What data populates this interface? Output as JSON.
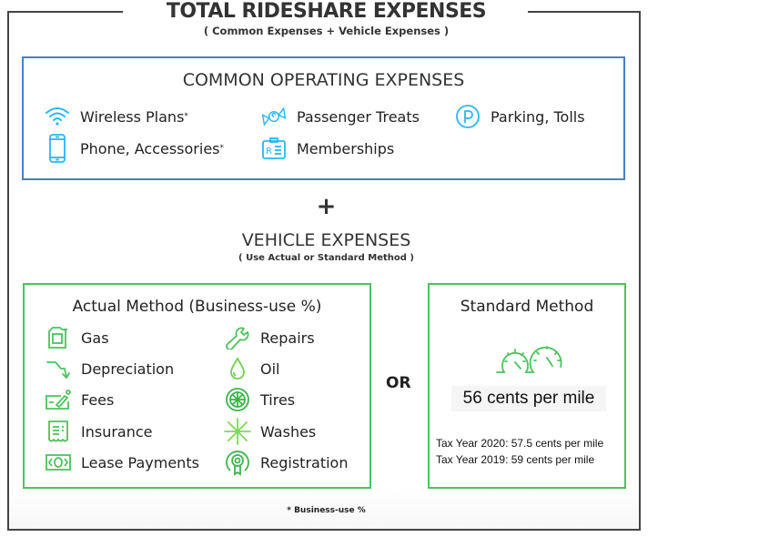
{
  "header": {
    "title": "TOTAL RIDESHARE EXPENSES",
    "subtitle": "( Common Expenses + Vehicle Expenses )"
  },
  "common": {
    "title": "COMMON OPERATING EXPENSES",
    "accent": "#29b6f6",
    "items": [
      {
        "label": "Wireless Plans",
        "asterisk": "*",
        "icon": "wifi-icon"
      },
      {
        "label": "Phone, Accessories",
        "asterisk": "*",
        "icon": "phone-icon"
      },
      {
        "label": "Passenger Treats",
        "asterisk": "",
        "icon": "candy-icon"
      },
      {
        "label": "Memberships",
        "asterisk": "",
        "icon": "id-card-icon"
      },
      {
        "label": "Parking, Tolls",
        "asterisk": "",
        "icon": "parking-icon"
      }
    ]
  },
  "plus": "+",
  "vehicle": {
    "title": "VEHICLE EXPENSES",
    "subtitle": "( Use Actual or Standard Method )",
    "accent": "#4cc25c",
    "actual": {
      "title": "Actual Method (Business-use %)",
      "items": [
        {
          "label": "Gas",
          "icon": "gas-can-icon"
        },
        {
          "label": "Depreciation",
          "icon": "trend-down-icon"
        },
        {
          "label": "Fees",
          "icon": "check-sign-icon"
        },
        {
          "label": "Insurance",
          "icon": "receipt-icon"
        },
        {
          "label": "Lease Payments",
          "icon": "cash-icon"
        },
        {
          "label": "Repairs",
          "icon": "wrench-icon"
        },
        {
          "label": "Oil",
          "icon": "oil-drop-icon"
        },
        {
          "label": "Tires",
          "icon": "tire-icon"
        },
        {
          "label": "Washes",
          "icon": "sparkle-icon"
        },
        {
          "label": "Registration",
          "icon": "badge-icon"
        }
      ]
    },
    "or_label": "OR",
    "standard": {
      "title": "Standard Method",
      "icon": "gauges-icon",
      "rate": "56 cents per mile",
      "history": [
        "Tax Year 2020: 57.5 cents per mile",
        "Tax Year 2019: 59 cents per mile"
      ]
    }
  },
  "footnote": "* Business-use %"
}
